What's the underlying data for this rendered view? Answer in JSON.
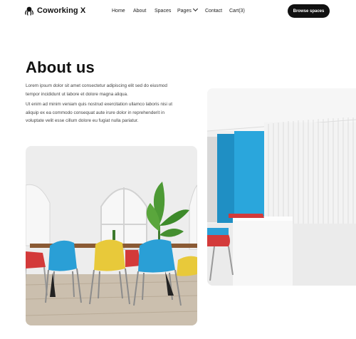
{
  "brand": {
    "name": "Coworking X",
    "logo_icon": "octopus-icon"
  },
  "nav": {
    "items": [
      "Home",
      "About",
      "Spaces",
      "Pages",
      "Contact",
      "Cart(3)"
    ],
    "pages_dropdown_icon": "chevron-down-icon"
  },
  "cta": {
    "label": "Browse spaces"
  },
  "about": {
    "title": "About us",
    "paragraph1": "Lorem ipsum dolor sit amet consectetur adipiscing elit sed do eiusmod tempor incididunt ut labore et dolore magna aliqua.",
    "paragraph2": "Ut enim ad minim veniam quis nostrud exercitation ullamco laboris nisi ut aliquip ex ea commodo consequat aute irure dolor in reprehenderit in voluptate velit esse cillum dolore eu fugiat nulla pariatur."
  },
  "colors": {
    "primary": "#111111",
    "text_muted": "#444444",
    "chair_blue": "#2a9fd6",
    "chair_yellow": "#e8c93a",
    "chair_red": "#d93a3a"
  }
}
